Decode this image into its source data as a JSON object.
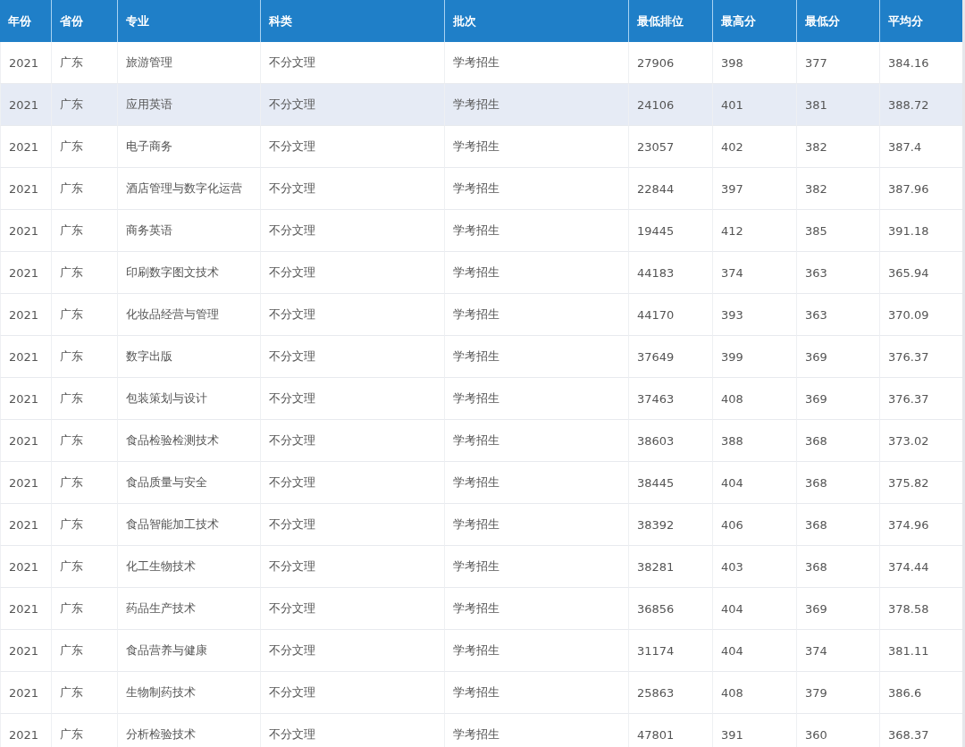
{
  "table": {
    "columns": [
      "年份",
      "省份",
      "专业",
      "科类",
      "批次",
      "最低排位",
      "最高分",
      "最低分",
      "平均分"
    ],
    "rows": [
      {
        "highlighted": false,
        "cells": [
          "2021",
          "广东",
          "旅游管理",
          "不分文理",
          "学考招生",
          "27906",
          "398",
          "377",
          "384.16"
        ]
      },
      {
        "highlighted": true,
        "cells": [
          "2021",
          "广东",
          "应用英语",
          "不分文理",
          "学考招生",
          "24106",
          "401",
          "381",
          "388.72"
        ]
      },
      {
        "highlighted": false,
        "cells": [
          "2021",
          "广东",
          "电子商务",
          "不分文理",
          "学考招生",
          "23057",
          "402",
          "382",
          "387.4"
        ]
      },
      {
        "highlighted": false,
        "cells": [
          "2021",
          "广东",
          "酒店管理与数字化运营",
          "不分文理",
          "学考招生",
          "22844",
          "397",
          "382",
          "387.96"
        ]
      },
      {
        "highlighted": false,
        "cells": [
          "2021",
          "广东",
          "商务英语",
          "不分文理",
          "学考招生",
          "19445",
          "412",
          "385",
          "391.18"
        ]
      },
      {
        "highlighted": false,
        "cells": [
          "2021",
          "广东",
          "印刷数字图文技术",
          "不分文理",
          "学考招生",
          "44183",
          "374",
          "363",
          "365.94"
        ]
      },
      {
        "highlighted": false,
        "cells": [
          "2021",
          "广东",
          "化妆品经营与管理",
          "不分文理",
          "学考招生",
          "44170",
          "393",
          "363",
          "370.09"
        ]
      },
      {
        "highlighted": false,
        "cells": [
          "2021",
          "广东",
          "数字出版",
          "不分文理",
          "学考招生",
          "37649",
          "399",
          "369",
          "376.37"
        ]
      },
      {
        "highlighted": false,
        "cells": [
          "2021",
          "广东",
          "包装策划与设计",
          "不分文理",
          "学考招生",
          "37463",
          "408",
          "369",
          "376.37"
        ]
      },
      {
        "highlighted": false,
        "cells": [
          "2021",
          "广东",
          "食品检验检测技术",
          "不分文理",
          "学考招生",
          "38603",
          "388",
          "368",
          "373.02"
        ]
      },
      {
        "highlighted": false,
        "cells": [
          "2021",
          "广东",
          "食品质量与安全",
          "不分文理",
          "学考招生",
          "38445",
          "404",
          "368",
          "375.82"
        ]
      },
      {
        "highlighted": false,
        "cells": [
          "2021",
          "广东",
          "食品智能加工技术",
          "不分文理",
          "学考招生",
          "38392",
          "406",
          "368",
          "374.96"
        ]
      },
      {
        "highlighted": false,
        "cells": [
          "2021",
          "广东",
          "化工生物技术",
          "不分文理",
          "学考招生",
          "38281",
          "403",
          "368",
          "374.44"
        ]
      },
      {
        "highlighted": false,
        "cells": [
          "2021",
          "广东",
          "药品生产技术",
          "不分文理",
          "学考招生",
          "36856",
          "404",
          "369",
          "378.58"
        ]
      },
      {
        "highlighted": false,
        "cells": [
          "2021",
          "广东",
          "食品营养与健康",
          "不分文理",
          "学考招生",
          "31174",
          "404",
          "374",
          "381.11"
        ]
      },
      {
        "highlighted": false,
        "cells": [
          "2021",
          "广东",
          "生物制药技术",
          "不分文理",
          "学考招生",
          "25863",
          "408",
          "379",
          "386.6"
        ]
      },
      {
        "highlighted": false,
        "cells": [
          "2021",
          "广东",
          "分析检验技术",
          "不分文理",
          "学考招生",
          "47801",
          "391",
          "360",
          "368.37"
        ]
      }
    ]
  }
}
